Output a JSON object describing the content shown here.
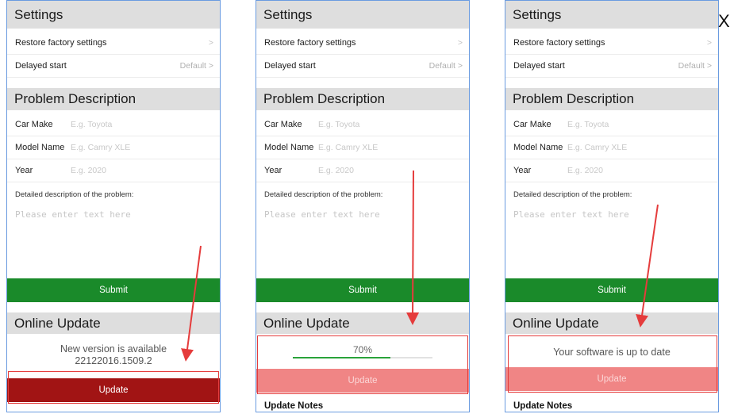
{
  "close_label": "X",
  "panels": [
    {
      "settings_title": "Settings",
      "restore_label": "Restore factory settings",
      "restore_chevron": ">",
      "delayed_label": "Delayed start",
      "delayed_value": "Default >",
      "problem_title": "Problem Description",
      "car_make_label": "Car Make",
      "car_make_placeholder": "E.g. Toyota",
      "model_label": "Model Name",
      "model_placeholder": "E.g. Camry XLE",
      "year_label": "Year",
      "year_placeholder": "E.g. 2020",
      "desc_label": "Detailed description of the problem:",
      "desc_placeholder": "Please enter text here",
      "submit_label": "Submit",
      "online_title": "Online Update",
      "status_line1": "New version is available",
      "status_line2": "22122016.1509.2",
      "update_label": "Update"
    },
    {
      "settings_title": "Settings",
      "restore_label": "Restore factory settings",
      "restore_chevron": ">",
      "delayed_label": "Delayed start",
      "delayed_value": "Default >",
      "problem_title": "Problem Description",
      "car_make_label": "Car Make",
      "car_make_placeholder": "E.g. Toyota",
      "model_label": "Model Name",
      "model_placeholder": "E.g. Camry XLE",
      "year_label": "Year",
      "year_placeholder": "E.g. 2020",
      "desc_label": "Detailed description of the problem:",
      "desc_placeholder": "Please enter text here",
      "submit_label": "Submit",
      "online_title": "Online Update",
      "progress_text": "70%",
      "progress_fraction": 0.7,
      "update_label": "Update",
      "notes_label": "Update Notes"
    },
    {
      "settings_title": "Settings",
      "restore_label": "Restore factory settings",
      "restore_chevron": ">",
      "delayed_label": "Delayed start",
      "delayed_value": "Default >",
      "problem_title": "Problem Description",
      "car_make_label": "Car Make",
      "car_make_placeholder": "E.g. Toyota",
      "model_label": "Model Name",
      "model_placeholder": "E.g. Camry XLE",
      "year_label": "Year",
      "year_placeholder": "E.g. 2020",
      "desc_label": "Detailed description of the problem:",
      "desc_placeholder": "Please enter text here",
      "submit_label": "Submit",
      "online_title": "Online Update",
      "status_text": "Your software is up to date",
      "update_label": "Update",
      "notes_label": "Update Notes"
    }
  ],
  "colors": {
    "submit_green": "#1a8a2a",
    "update_active": "#a11414",
    "update_disabled": "#f08585",
    "annotation_red": "#e53c3c",
    "panel_border": "#6a9be0"
  }
}
